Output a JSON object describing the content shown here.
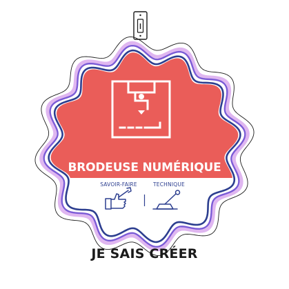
{
  "badge": {
    "title": "BRODEUSE NUMÉRIQUE",
    "categories": {
      "left": "SAVOIR-FAIRE",
      "right": "TECHNIQUE"
    },
    "caption": "JE SAIS CRÉER",
    "icons": {
      "hanger": "lightswitch-hanger-icon",
      "machine": "embroidery-machine-icon",
      "skill": "hand-wrench-icon",
      "technique": "lever-icon"
    },
    "colors": {
      "banner_red": "#ea5d59",
      "outline_navy": "#2c3e8f",
      "outline_purple": "#7b5bd6",
      "outline_lilac": "#dfb6f0",
      "text_dark": "#1a1a1a"
    }
  }
}
